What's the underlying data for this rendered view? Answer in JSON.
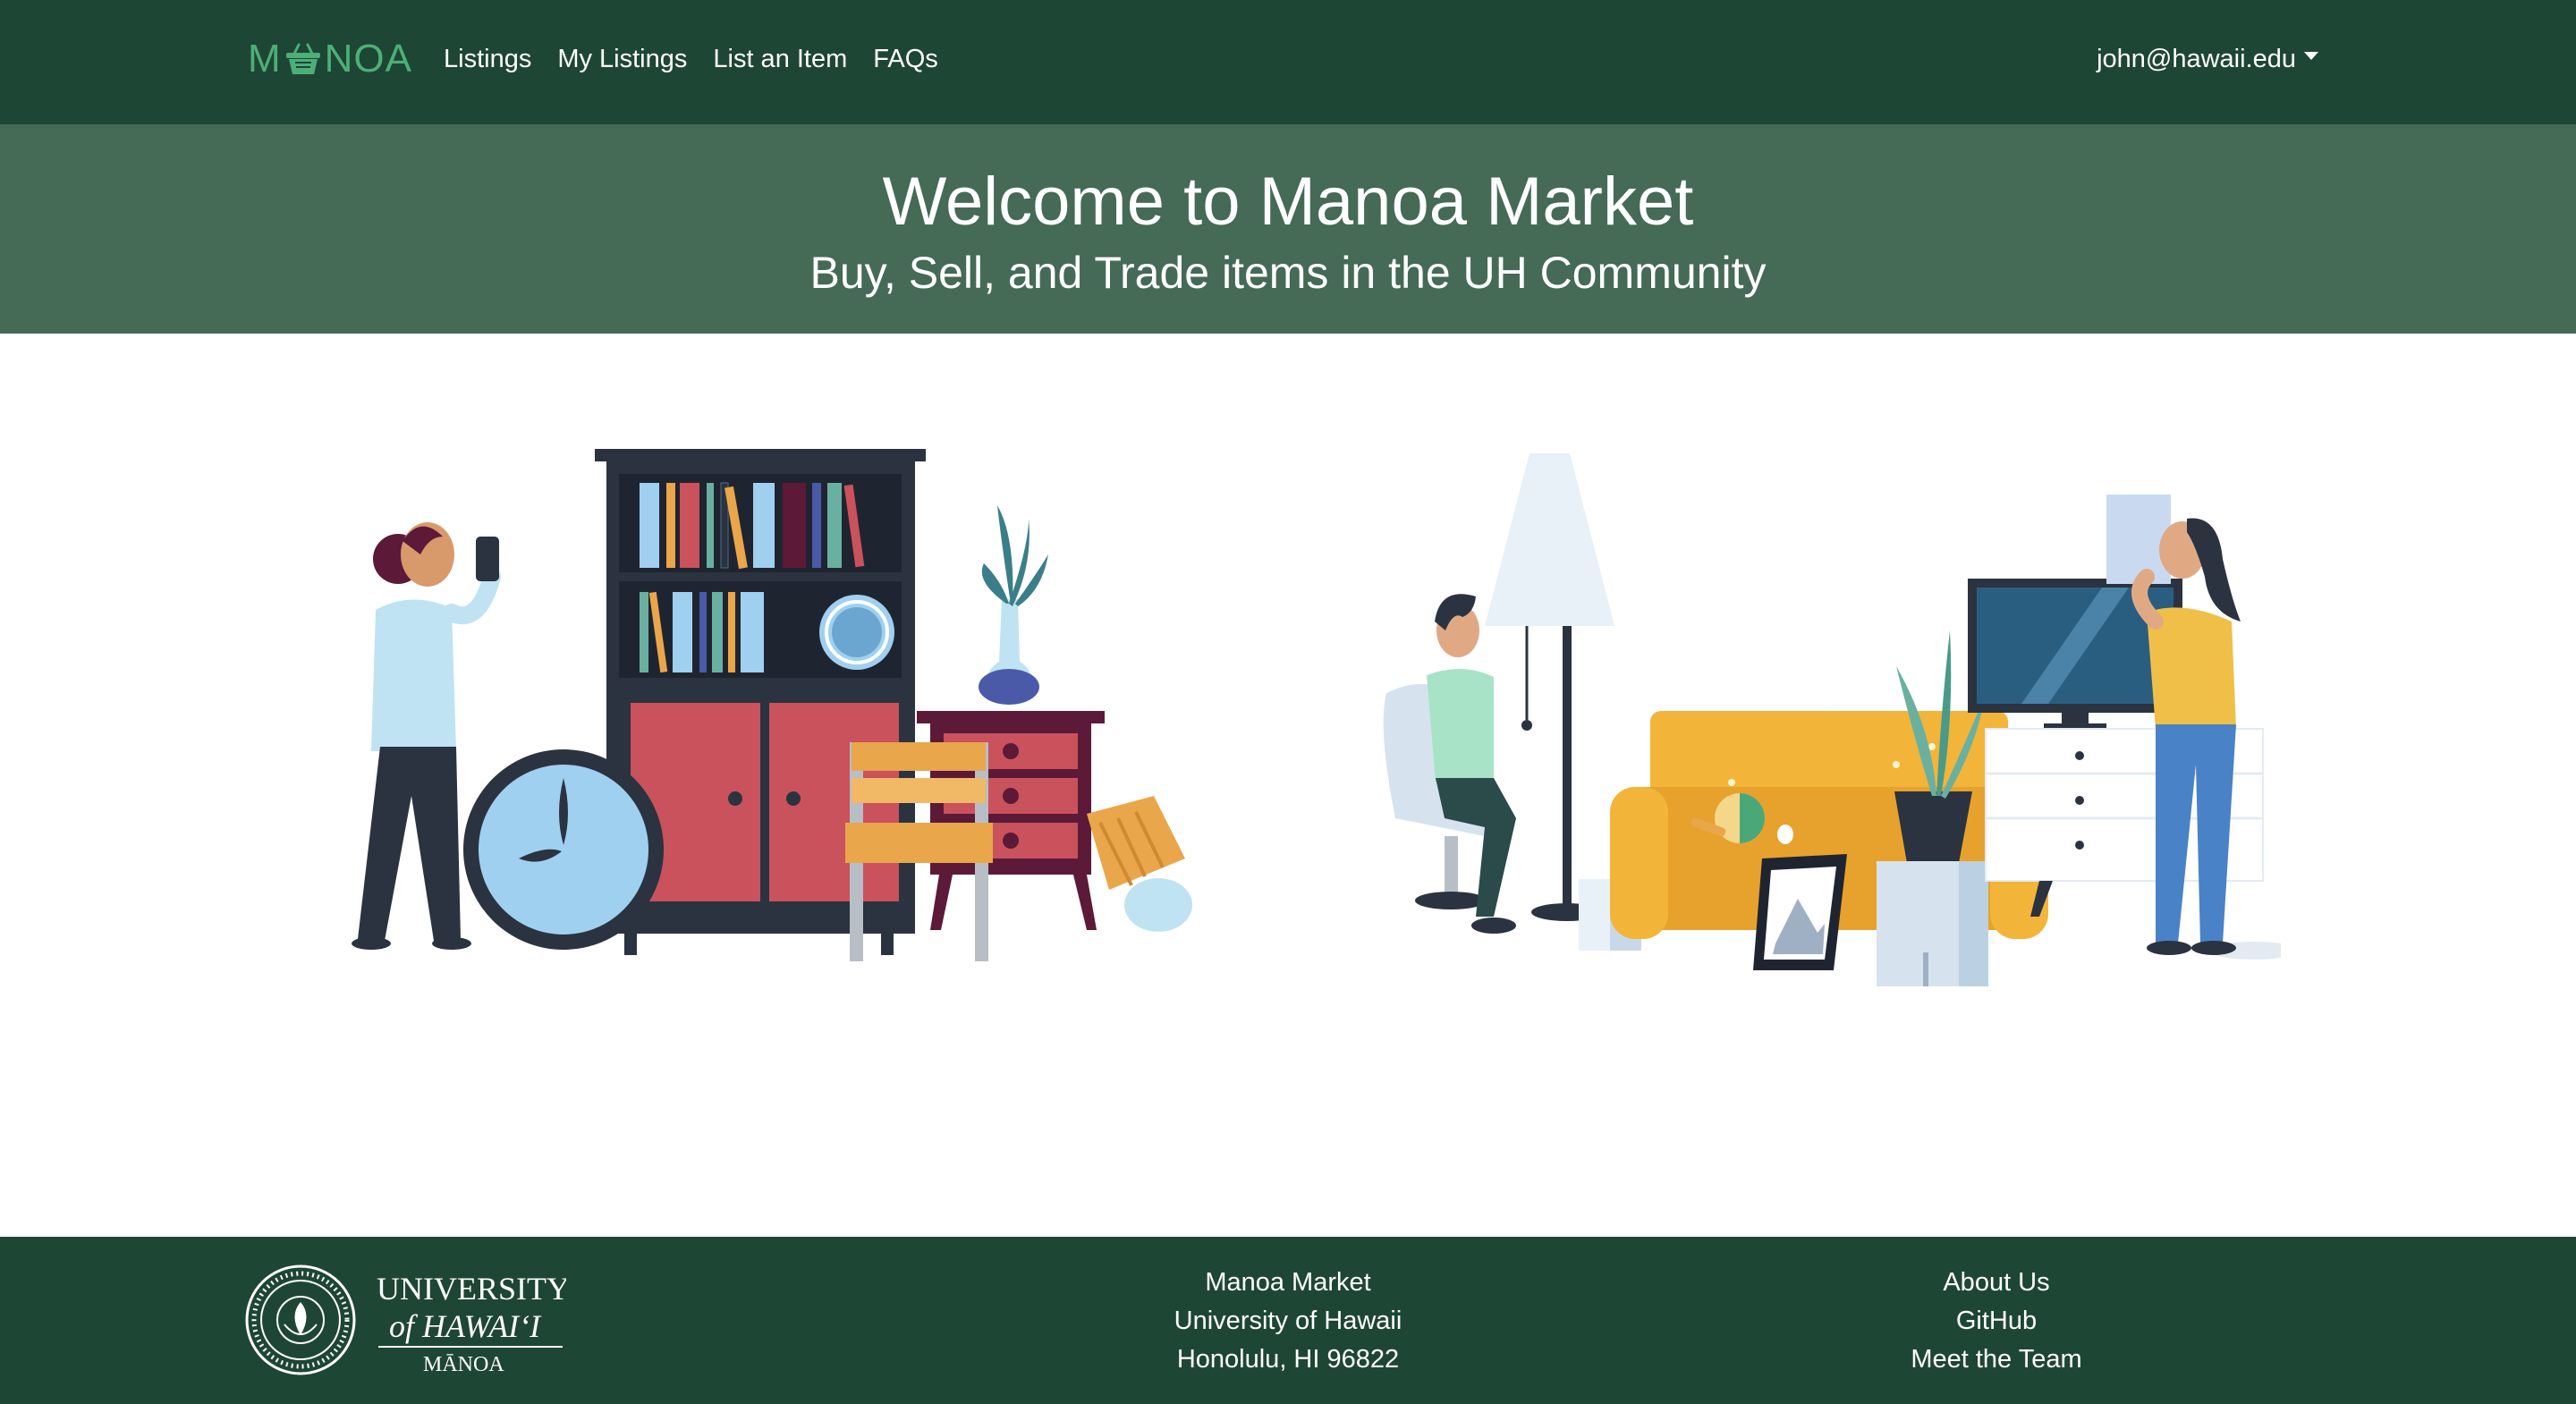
{
  "navbar": {
    "brand_left": "M",
    "brand_right": "NOA",
    "brand_icon": "basket-icon",
    "links": [
      "Listings",
      "My Listings",
      "List an Item",
      "FAQs"
    ],
    "user": "john@hawaii.edu",
    "colors": {
      "background": "#1e4634",
      "brand": "#4caf78"
    }
  },
  "hero": {
    "title": "Welcome to Manoa Market",
    "subtitle": "Buy, Sell, and Trade items in the UH Community",
    "background": "#456a56"
  },
  "illustrations": {
    "left": "woman-photographing-furniture-illustration",
    "right": "living-room-furniture-illustration"
  },
  "footer": {
    "logo": {
      "line1": "UNIVERSITY",
      "line2": "of HAWAI‘I",
      "line3": "MĀNOA",
      "seal": "uh-seal-icon"
    },
    "address": [
      "Manoa Market",
      "University of Hawaii",
      "Honolulu, HI 96822"
    ],
    "links": [
      "About Us",
      "GitHub",
      "Meet the Team"
    ]
  }
}
